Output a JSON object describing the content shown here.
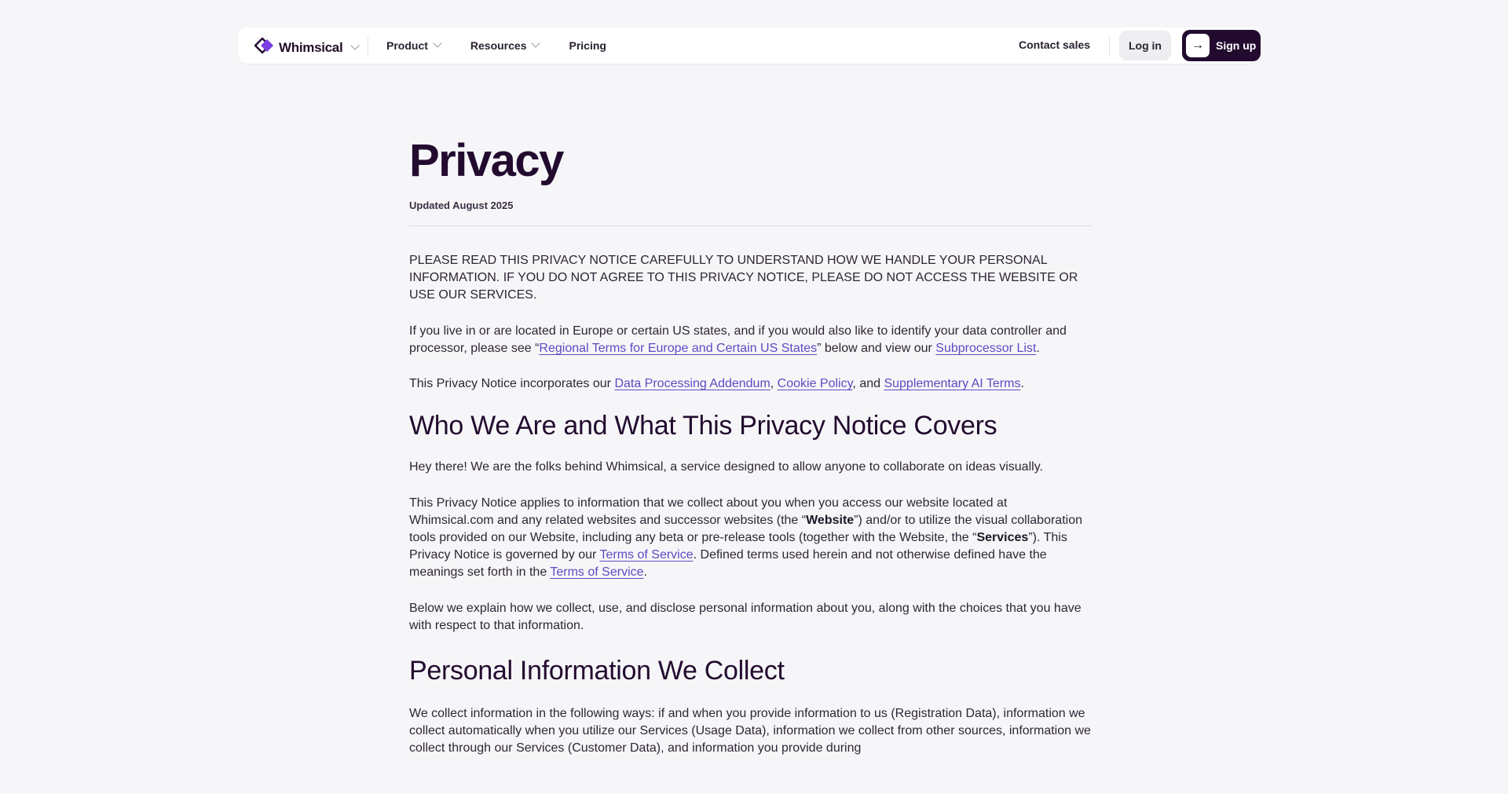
{
  "nav": {
    "brand": "Whimsical",
    "menu": [
      {
        "label": "Product",
        "has_dropdown": true
      },
      {
        "label": "Resources",
        "has_dropdown": true
      },
      {
        "label": "Pricing",
        "has_dropdown": false
      }
    ],
    "contact_sales": "Contact sales",
    "login": "Log in",
    "signup": "Sign up",
    "colors": {
      "brand_dark": "#230b2f",
      "logo_purple": "#7b3fe4",
      "link": "#5b4bc4"
    }
  },
  "content": {
    "title": "Privacy",
    "updated": "Updated August 2025",
    "notice_caps": "PLEASE READ THIS PRIVACY NOTICE CAREFULLY TO UNDERSTAND HOW WE HANDLE YOUR PERSONAL INFORMATION. IF YOU DO NOT AGREE TO THIS PRIVACY NOTICE, PLEASE DO NOT ACCESS THE WEBSITE OR USE OUR SERVICES.",
    "europe": {
      "before": "If you live in or are located in Europe or certain US states, and if you would also like to identify your data controller and processor, please see “",
      "link1": "Regional Terms for Europe and Certain US States",
      "middle": "” below and view our ",
      "link2": "Subprocessor List",
      "after": "."
    },
    "incorporates": {
      "before": "This Privacy Notice incorporates our ",
      "link1": "Data Processing Addendum",
      "sep1": ", ",
      "link2": "Cookie Policy",
      "sep2": ", and ",
      "link3": "Supplementary AI Terms",
      "after": "."
    },
    "section1_heading": "Who We Are and What This Privacy Notice Covers",
    "intro": "Hey there! We are the folks behind Whimsical, a service designed to allow anyone to collaborate on ideas visually.",
    "applies": {
      "t1": "This Privacy Notice applies to information that we collect about you when you access our website located at Whimsical.com and any related websites and successor websites (the “",
      "b1": "Website",
      "t2": "”) and/or to utilize the visual collaboration tools provided on our Website, including any beta or pre-release tools (together with the Website, the “",
      "b2": "Services",
      "t3": "”). This Privacy Notice is governed by our ",
      "link1": "Terms of Service",
      "t4": ". Defined terms used herein and not otherwise defined have the meanings set forth in the ",
      "link2": "Terms of Service",
      "t5": "."
    },
    "below": "Below we explain how we collect, use, and disclose personal information about you, along with the choices that you have with respect to that information.",
    "section2_heading": "Personal Information We Collect",
    "collect": "We collect information in the following ways: if and when you provide information to us (Registration Data), information we collect automatically when you utilize our Services (Usage Data), information we collect from other sources, information we collect through our Services (Customer Data), and information you provide during"
  }
}
